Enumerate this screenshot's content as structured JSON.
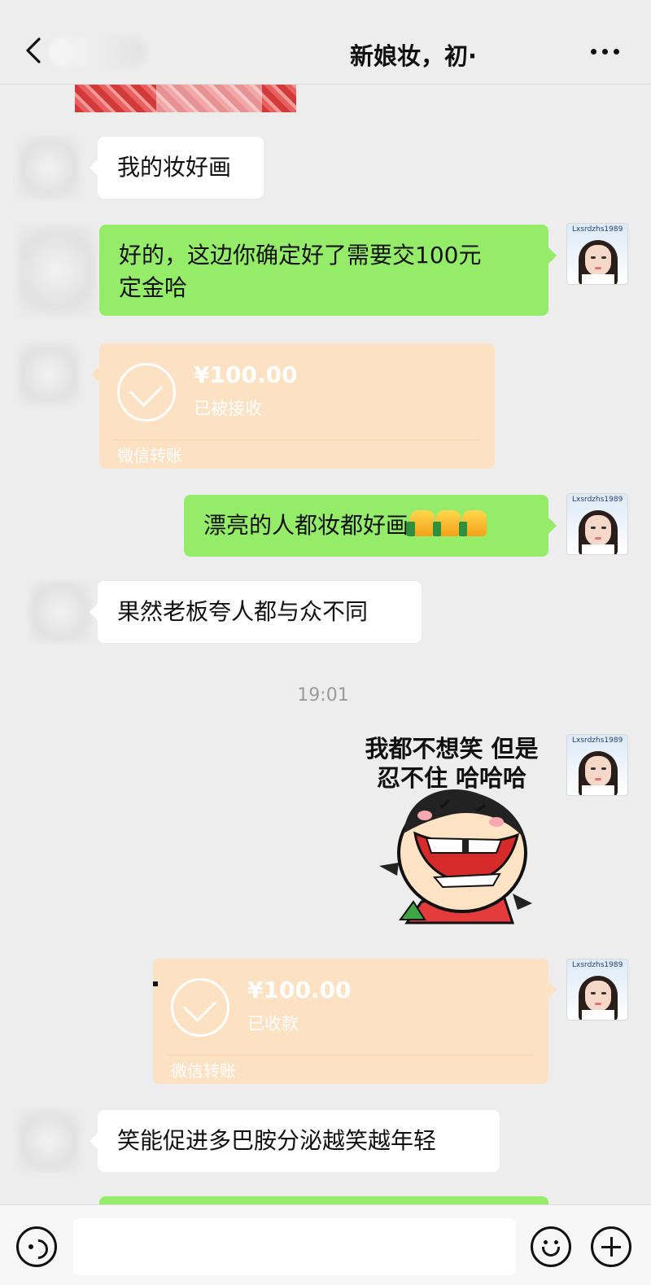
{
  "header": {
    "title": "新娘妆，初·"
  },
  "messages": {
    "m1": "我的妆好画",
    "m2": "好的，这边你确定好了需要交100元定金哈",
    "m2_line1": "好的，这边你确定好了需要交100元",
    "m2_line2": "定金哈",
    "m4": "漂亮的人都妆都好画",
    "m5": "果然老板夸人都与众不同",
    "m7": "笑能促进多巴胺分泌越笑越年轻"
  },
  "transfer1": {
    "amount": "¥100.00",
    "status": "已被接收",
    "label": "微信转账"
  },
  "transfer2": {
    "amount": "¥100.00",
    "status": "已收款",
    "label": "微信转账"
  },
  "timestamp": "19:01",
  "sticker": {
    "line1": "我都不想笑 但是",
    "line2": "忍不住 哈哈哈"
  },
  "avatar_tag": "Lxsrdzhs1989",
  "colors": {
    "background": "#ededed",
    "bubble_green": "#95ec69",
    "bubble_white": "#ffffff",
    "transfer_card": "#fde1c3"
  },
  "icons": [
    "back-chevron-icon",
    "more-dots-icon",
    "voice-icon",
    "emoji-icon",
    "plus-icon",
    "check-circle-icon",
    "thumbs-up-icon"
  ]
}
